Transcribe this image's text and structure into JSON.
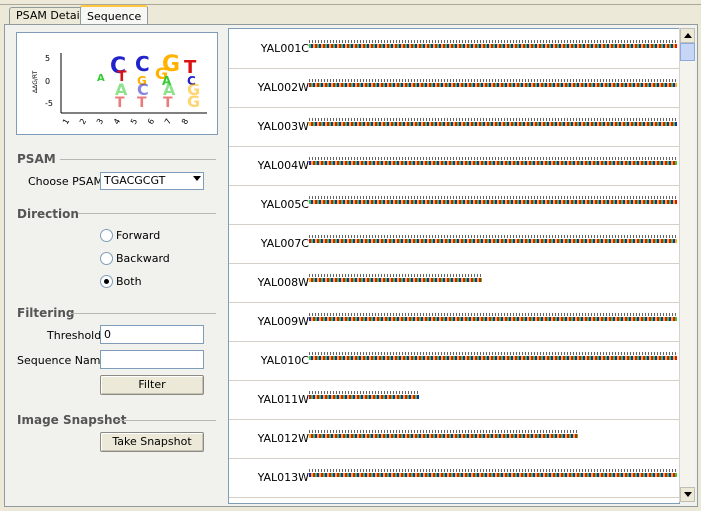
{
  "tabs": [
    {
      "label": "PSAM Detail",
      "active": false
    },
    {
      "label": "Sequence",
      "active": true
    }
  ],
  "logo": {
    "y_axis_label": "ΔΔG/RT",
    "y_ticks": [
      "5",
      "0",
      "-5"
    ],
    "x_ticks": [
      "1",
      "2",
      "3",
      "4",
      "5",
      "6",
      "7",
      "8"
    ],
    "upper_letters": [
      "G",
      "T",
      "C",
      "C",
      "G",
      "T",
      "G",
      "A",
      "C",
      "A"
    ],
    "lower_letters": [
      "A",
      "C",
      "A",
      "G",
      "T",
      "T",
      "T",
      "G"
    ]
  },
  "psam": {
    "section_title": "PSAM",
    "choose_label": "Choose PSAM",
    "selected": "TGACGCGT"
  },
  "direction": {
    "section_title": "Direction",
    "options": [
      "Forward",
      "Backward",
      "Both"
    ],
    "selected": "Both"
  },
  "filtering": {
    "section_title": "Filtering",
    "threshold_label": "Threshold",
    "threshold_value": "0",
    "sequence_name_label": "Sequence Name",
    "sequence_name_value": "",
    "filter_button": "Filter"
  },
  "snapshot": {
    "section_title": "Image Snapshot",
    "button": "Take Snapshot"
  },
  "sequences": [
    {
      "name": "YAL001C",
      "length_frac": 1.0
    },
    {
      "name": "YAL002W",
      "length_frac": 1.0
    },
    {
      "name": "YAL003W",
      "length_frac": 1.0
    },
    {
      "name": "YAL004W",
      "length_frac": 1.0
    },
    {
      "name": "YAL005C",
      "length_frac": 1.0
    },
    {
      "name": "YAL007C",
      "length_frac": 1.0
    },
    {
      "name": "YAL008W",
      "length_frac": 0.47
    },
    {
      "name": "YAL009W",
      "length_frac": 1.0
    },
    {
      "name": "YAL010C",
      "length_frac": 1.0
    },
    {
      "name": "YAL011W",
      "length_frac": 0.3
    },
    {
      "name": "YAL012W",
      "length_frac": 0.73
    },
    {
      "name": "YAL013W",
      "length_frac": 1.0
    }
  ],
  "base_colors": {
    "A": "#33CC33",
    "C": "#2222CC",
    "G": "#FFB300",
    "T": "#DD1111"
  }
}
